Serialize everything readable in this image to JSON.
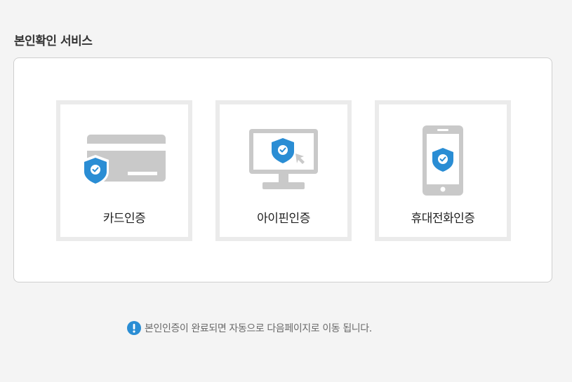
{
  "page": {
    "title": "본인확인 서비스",
    "notice": "본인인증이 완료되면 자동으로 다음페이지로 이동 됩니다."
  },
  "methods": [
    {
      "label": "카드인증",
      "icon": "credit-card-shield-icon"
    },
    {
      "label": "아이핀인증",
      "icon": "monitor-shield-cursor-icon"
    },
    {
      "label": "휴대전화인증",
      "icon": "smartphone-shield-icon"
    }
  ],
  "colors": {
    "accent": "#2a8dd4",
    "icon_gray": "#c9c9c9",
    "card_border": "#ebebeb",
    "page_bg": "#f4f4f4"
  }
}
